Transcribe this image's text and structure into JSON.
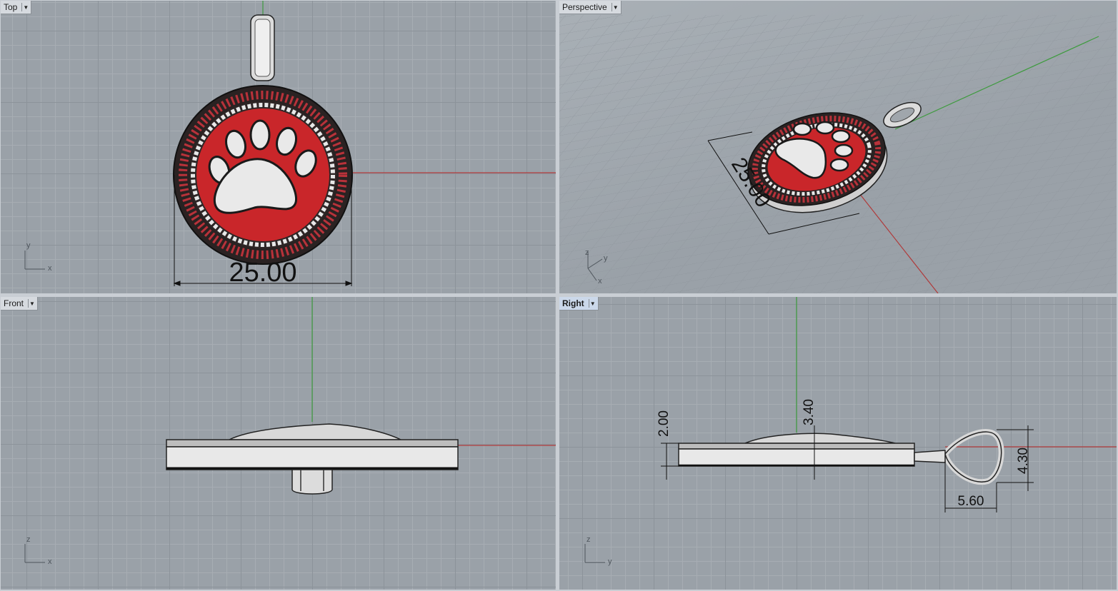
{
  "viewports": {
    "top": {
      "title": "Top",
      "dimension": "25.00",
      "axes": {
        "v": "y",
        "h": "x"
      }
    },
    "perspective": {
      "title": "Perspective",
      "dimension": "25.00",
      "axes": {
        "z": "z",
        "y": "y",
        "x": "x"
      }
    },
    "front": {
      "title": "Front",
      "axes": {
        "v": "z",
        "h": "x"
      }
    },
    "right": {
      "title": "Right",
      "dimensions": {
        "thickness": "2.00",
        "height": "3.40",
        "bail_height": "4.30",
        "bail_width": "5.60"
      },
      "axes": {
        "v": "z",
        "h": "y"
      }
    }
  },
  "icons": {
    "viewport_menu": "dropdown-arrow-icon"
  },
  "colors": {
    "background": "#9aa1a8",
    "grid_minor": "#a7adb3",
    "grid_major": "#8c939a",
    "x_axis": "#b03a3a",
    "y_axis": "#3e9b3e",
    "enamel_red": "#c9262a",
    "metal": "#e4e4e4",
    "active_tab": "#cbd8ea"
  }
}
